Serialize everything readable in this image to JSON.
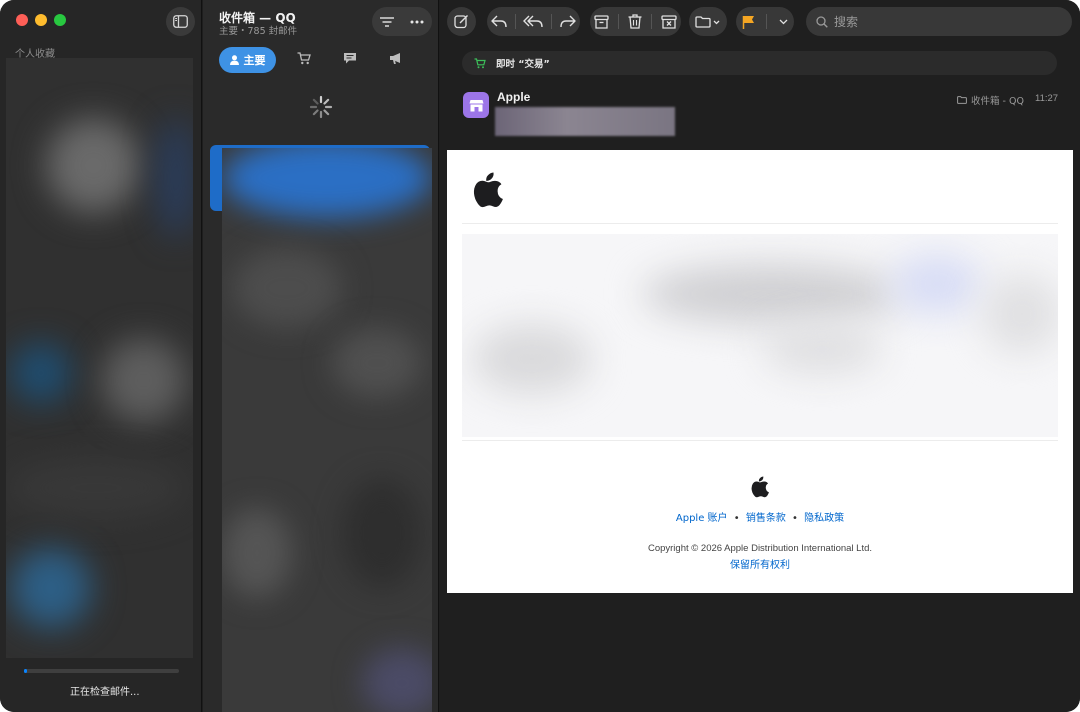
{
  "sidebar": {
    "section_title": "个人收藏",
    "status_text": "正在检查邮件...",
    "progress_fraction": 0.02
  },
  "message_list": {
    "mailbox_title": "收件箱 — QQ",
    "mailbox_subtitle": "主要・785 封邮件",
    "primary_category_label": "主要"
  },
  "toolbar": {
    "search_placeholder": "搜索"
  },
  "message": {
    "category_banner": "即时 “交易”",
    "sender": "Apple",
    "folder": "收件箱 - QQ",
    "time": "11:27"
  },
  "mail_body": {
    "link_account": "Apple 账户",
    "link_terms": "销售条款",
    "link_privacy": "隐私政策",
    "separator": "•",
    "copyright": "Copyright © 2026 Apple Distribution International Ltd.",
    "rights": "保留所有权利"
  },
  "colors": {
    "accent_blue": "#3e92e5",
    "flag_orange": "#f5a623",
    "avatar_purple": "#9c75e8",
    "link_blue": "#0066cc"
  }
}
